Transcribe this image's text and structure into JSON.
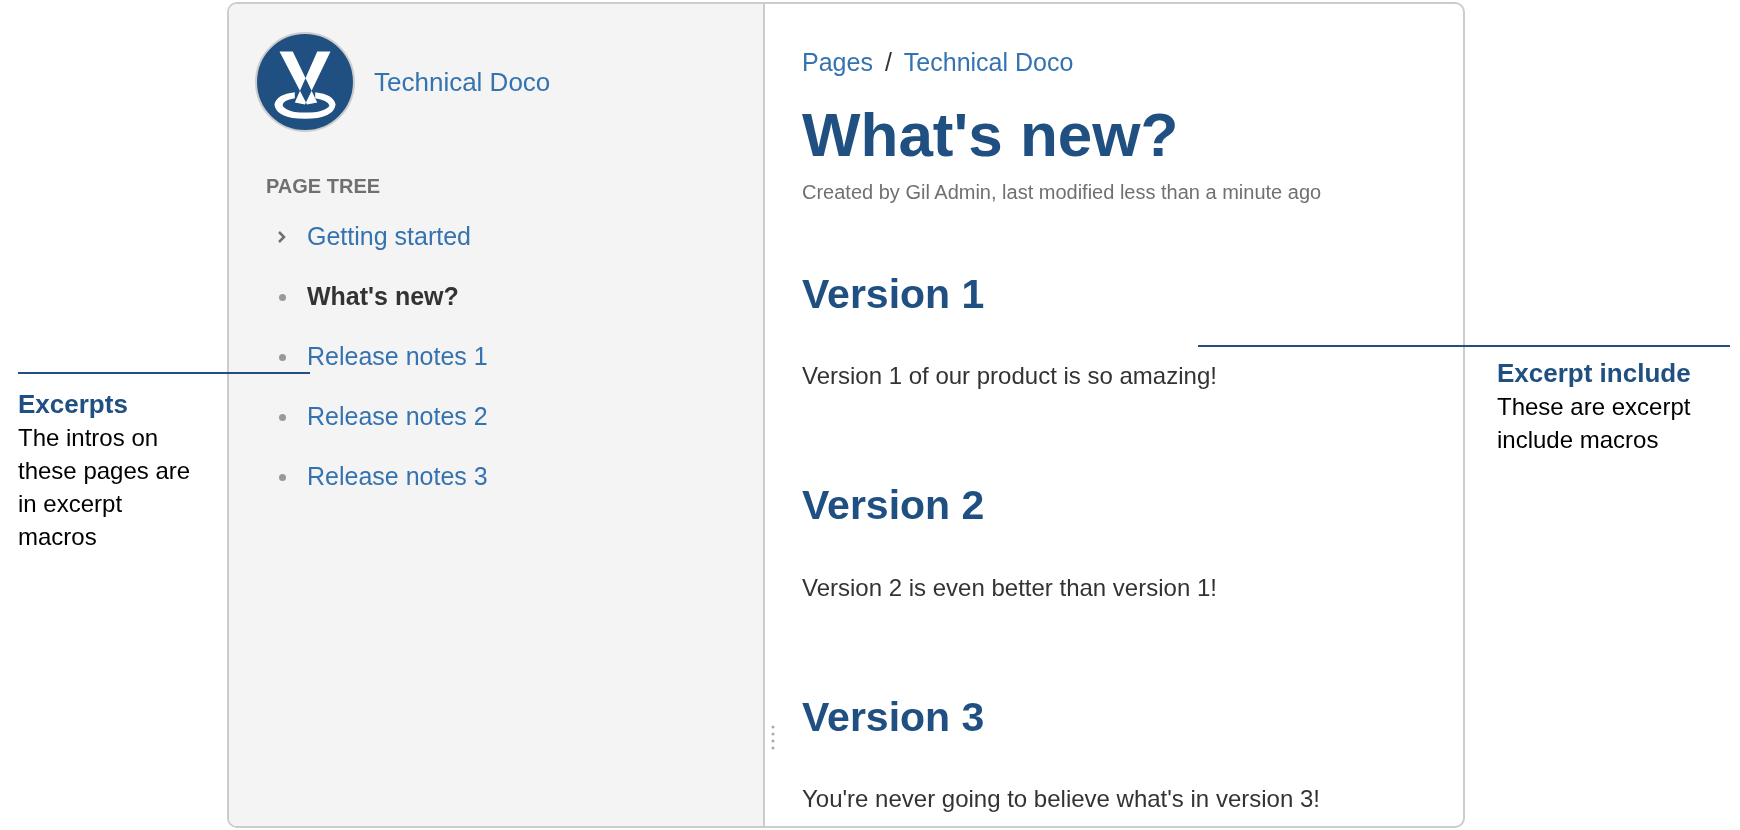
{
  "space": {
    "name": "Technical Doco"
  },
  "sidebar": {
    "heading": "PAGE TREE",
    "items": [
      {
        "label": "Getting started",
        "kind": "expandable",
        "selected": false
      },
      {
        "label": "What's new?",
        "kind": "leaf",
        "selected": true
      },
      {
        "label": "Release notes 1",
        "kind": "leaf",
        "selected": false
      },
      {
        "label": "Release notes 2",
        "kind": "leaf",
        "selected": false
      },
      {
        "label": "Release notes 3",
        "kind": "leaf",
        "selected": false
      }
    ]
  },
  "breadcrumbs": {
    "items": [
      "Pages",
      "Technical Doco"
    ],
    "separator": "/"
  },
  "page": {
    "title": "What's new?",
    "byline": "Created by Gil Admin, last modified less than a minute ago",
    "sections": [
      {
        "heading": "Version 1",
        "text": "Version 1 of our product is so amazing!"
      },
      {
        "heading": "Version 2",
        "text": "Version 2 is even better than version 1!"
      },
      {
        "heading": "Version 3",
        "text": "You're never going to believe what's in version 3!"
      }
    ]
  },
  "left_annotation": {
    "title": "Excerpts",
    "text": "The intros on these pages are in excerpt macros"
  },
  "right_annotation": {
    "title": "Excerpt include",
    "text": "These are excerpt include macros"
  }
}
